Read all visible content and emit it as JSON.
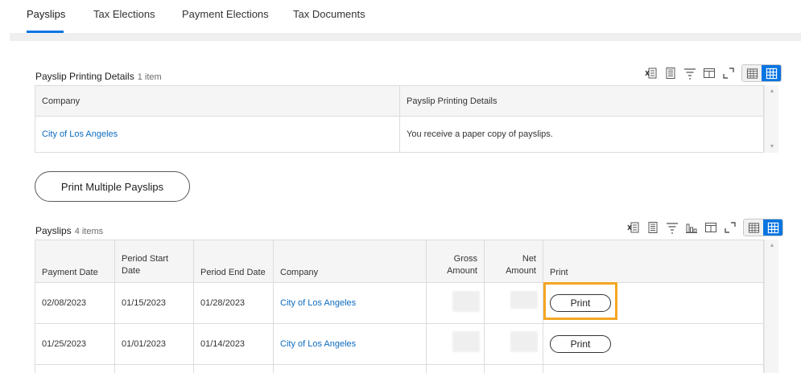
{
  "tabs": [
    {
      "label": "Payslips",
      "active": true
    },
    {
      "label": "Tax Elections",
      "active": false
    },
    {
      "label": "Payment Elections",
      "active": false
    },
    {
      "label": "Tax Documents",
      "active": false
    }
  ],
  "printing_details": {
    "title": "Payslip Printing Details",
    "count": "1 item",
    "columns": [
      "Company",
      "Payslip Printing Details"
    ],
    "rows": [
      {
        "company": "City of Los Angeles",
        "details": "You receive a paper copy of payslips."
      }
    ]
  },
  "print_multiple_label": "Print Multiple Payslips",
  "payslips": {
    "title": "Payslips",
    "count": "4 items",
    "columns": {
      "payment_date": "Payment Date",
      "period_start_1": "Period Start",
      "period_start_2": "Date",
      "period_end": "Period End Date",
      "company": "Company",
      "gross_1": "Gross",
      "gross_2": "Amount",
      "net_1": "Net",
      "net_2": "Amount",
      "print": "Print"
    },
    "rows": [
      {
        "payment_date": "02/08/2023",
        "period_start": "01/15/2023",
        "period_end": "01/28/2023",
        "company": "City of Los Angeles",
        "print": "Print"
      },
      {
        "payment_date": "01/25/2023",
        "period_start": "01/01/2023",
        "period_end": "01/14/2023",
        "company": "City of Los Angeles",
        "print": "Print"
      }
    ]
  },
  "colors": {
    "accent": "#0875e1",
    "link": "#0e6bc0",
    "highlight": "#f5a623"
  },
  "icons": [
    "export-excel-icon",
    "export-pdf-icon",
    "filter-icon",
    "chart-icon",
    "column-icon",
    "fullscreen-icon",
    "table-view-icon",
    "grid-view-icon"
  ]
}
